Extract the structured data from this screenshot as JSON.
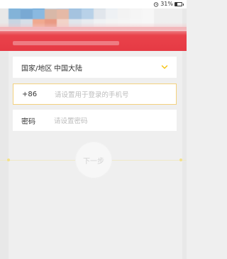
{
  "status_bar": {
    "battery_text": "31%",
    "battery_level": 0.31,
    "icons": [
      "alarm-icon",
      "battery-icon"
    ]
  },
  "header": {
    "mosaic_colors": [
      "#7fb7e0",
      "#8fc2e8",
      "#6aa9da",
      "#c9d3e0",
      "#b7cde2",
      "#9bc1e2",
      "#a8cde9",
      "#d5dde6",
      "#e7eef4",
      "#f0f0f0",
      "#f3f3f3",
      "#f6f6f6",
      "#83b3d8",
      "#79a9d3",
      "#8ab9e0",
      "#d8b8a8",
      "#e5b9a6",
      "#a5c3df",
      "#b8d1e8",
      "#e1e6ec",
      "#eef1f4",
      "#f3f3f3",
      "#f5f5f5",
      "#f7f7f7",
      "#c8d5e2",
      "#d6dfe8",
      "#f0a98f",
      "#e99a84",
      "#f2d3c8",
      "#e0e6ec",
      "#e8ecf0",
      "#f0f2f4",
      "#f4f4f4",
      "#f5f5f5",
      "#f6f6f6",
      "#f7f7f7"
    ],
    "accent": "#e63a44"
  },
  "form": {
    "country": {
      "label": "国家/地区",
      "value": "中国大陆",
      "icon": "chevron-down-icon",
      "chevron_color": "#f5c518"
    },
    "phone": {
      "prefix": "+86",
      "placeholder": "请设置用于登录的手机号",
      "border_color": "#f3d17e"
    },
    "password": {
      "label": "密码",
      "placeholder": "请设置密码"
    }
  },
  "next_button": {
    "label": "下一步"
  }
}
